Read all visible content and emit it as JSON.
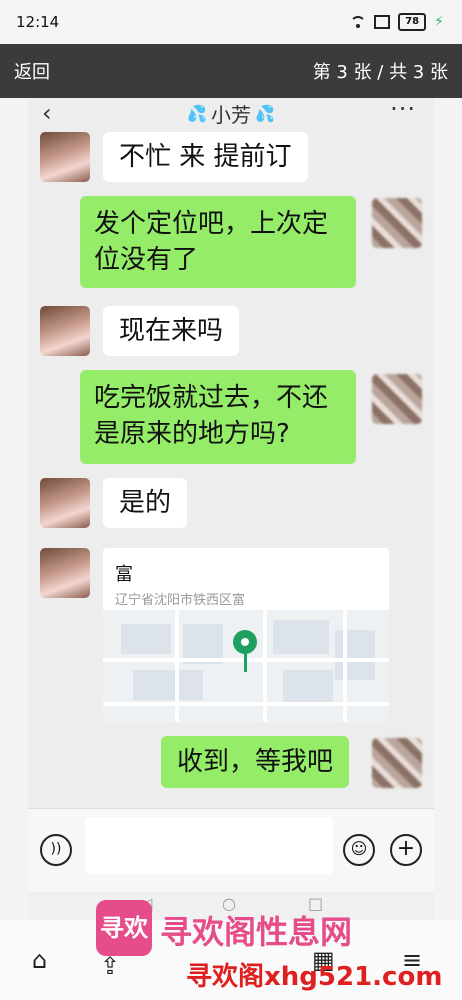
{
  "status_bar": {
    "time": "12:14",
    "battery": "78"
  },
  "viewer": {
    "back_label": "返回",
    "page_indicator": "第 3 张 / 共 3 张"
  },
  "chat": {
    "contact_name": "小芳",
    "back_glyph": "‹",
    "more_glyph": "···",
    "messages": [
      {
        "side": "left",
        "text": "不忙 来 提前订"
      },
      {
        "side": "right",
        "text": "发个定位吧，上次定位没有了"
      },
      {
        "side": "left",
        "text": "现在来吗"
      },
      {
        "side": "right",
        "text": "吃完饭就过去，不还是原来的地方吗?"
      },
      {
        "side": "left",
        "text": "是的"
      },
      {
        "side": "right",
        "text": "收到，等我吧"
      }
    ],
    "location": {
      "name": "富",
      "address": "辽宁省沈阳市铁西区富"
    }
  },
  "input_bar": {
    "placeholder": ""
  },
  "watermark": {
    "logo_text": "寻欢",
    "title": "寻欢阁性息网",
    "url": "寻欢阁xhg521.com"
  }
}
